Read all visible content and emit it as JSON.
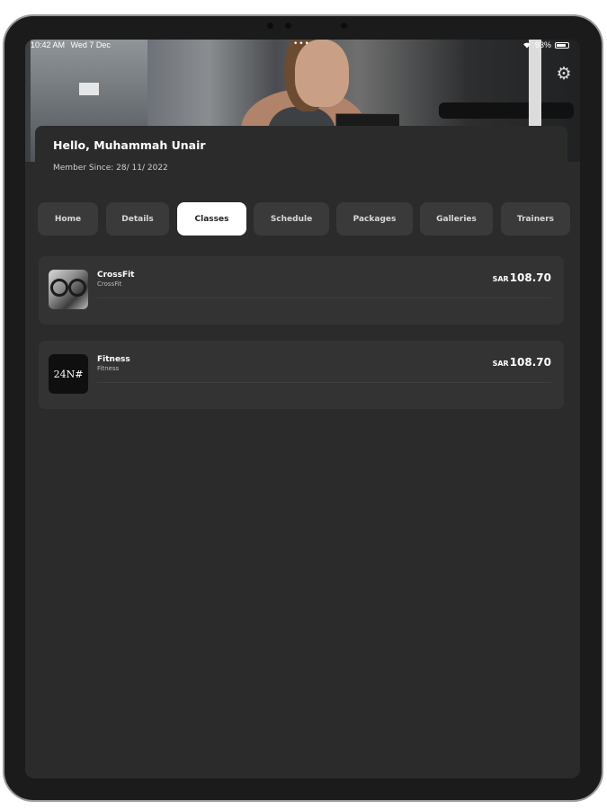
{
  "status_bar": {
    "time": "10:42 AM",
    "date": "Wed 7 Dec",
    "battery": "93%"
  },
  "header": {
    "greeting": "Hello, Muhammah Unair",
    "member_since": "Member Since:  28/ 11/ 2022"
  },
  "tabs": [
    {
      "label": "Home"
    },
    {
      "label": "Details"
    },
    {
      "label": "Classes",
      "active": true
    },
    {
      "label": "Schedule"
    },
    {
      "label": "Packages"
    },
    {
      "label": "Galleries"
    },
    {
      "label": "Trainers"
    }
  ],
  "classes": [
    {
      "name": "CrossFit",
      "category": "CrossFit",
      "currency": "SAR",
      "price": "108.70",
      "thumb_icon": "crossfit-image"
    },
    {
      "name": "Fitness",
      "category": "Fitness",
      "currency": "SAR",
      "price": "108.70",
      "thumb_icon": "fitness-logo",
      "thumb_text": "24N#"
    }
  ],
  "icons": {
    "settings": "gear-icon",
    "wifi": "wifi-icon",
    "battery": "battery-icon"
  },
  "colors": {
    "background": "#2b2b2b",
    "card": "#333333",
    "tab": "#3a3a3a",
    "tab_active": "#ffffff",
    "text": "#ffffff"
  }
}
